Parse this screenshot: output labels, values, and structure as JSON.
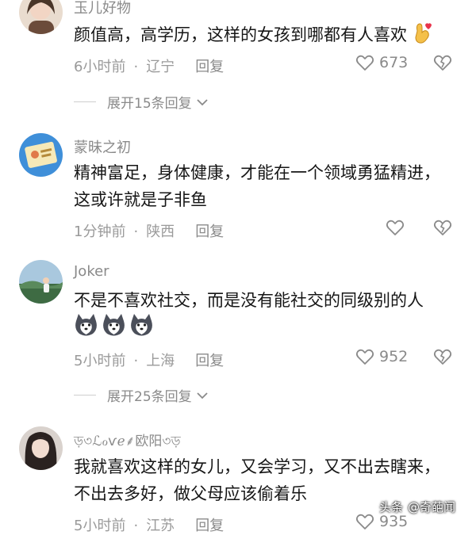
{
  "comments": [
    {
      "username": "玉儿好物",
      "text": "颜值高，高学历，这样的女孩到哪都有人喜欢",
      "time": "6小时前",
      "location": "辽宁",
      "reply_label": "回复",
      "likes": "673",
      "expand_label": "展开15条回复",
      "trailing_emoji": "hand-heart-icon"
    },
    {
      "username": "蒙昧之初",
      "text": "精神富足，身体健康，才能在一个领域勇猛精进，这或许就是子非鱼",
      "time": "1分钟前",
      "location": "陕西",
      "reply_label": "回复",
      "likes": ""
    },
    {
      "username": "Joker",
      "text": "不是不喜欢社交，而是没有能社交的同级别的人",
      "emojis": [
        "husky-dog-icon",
        "husky-dog-icon",
        "husky-dog-icon"
      ],
      "time": "5小时前",
      "location": "上海",
      "reply_label": "回复",
      "likes": "952",
      "expand_label": "展开25条回复"
    },
    {
      "username": "ড়৩ℒℴѵℯ⸙欧阳৩ড়",
      "text": "我就喜欢这样的女儿，又会学习，又不出去瞎来，不出去多好，做父母应该偷着乐",
      "time": "5小时前",
      "location": "江苏",
      "reply_label": "回复",
      "likes": "935"
    }
  ],
  "watermark": {
    "platform": "头条",
    "account": "@奇葩闻"
  },
  "colors": {
    "muted_text": "#8a8a8a",
    "body_text": "#161616",
    "divider": "#cfcfcf"
  }
}
